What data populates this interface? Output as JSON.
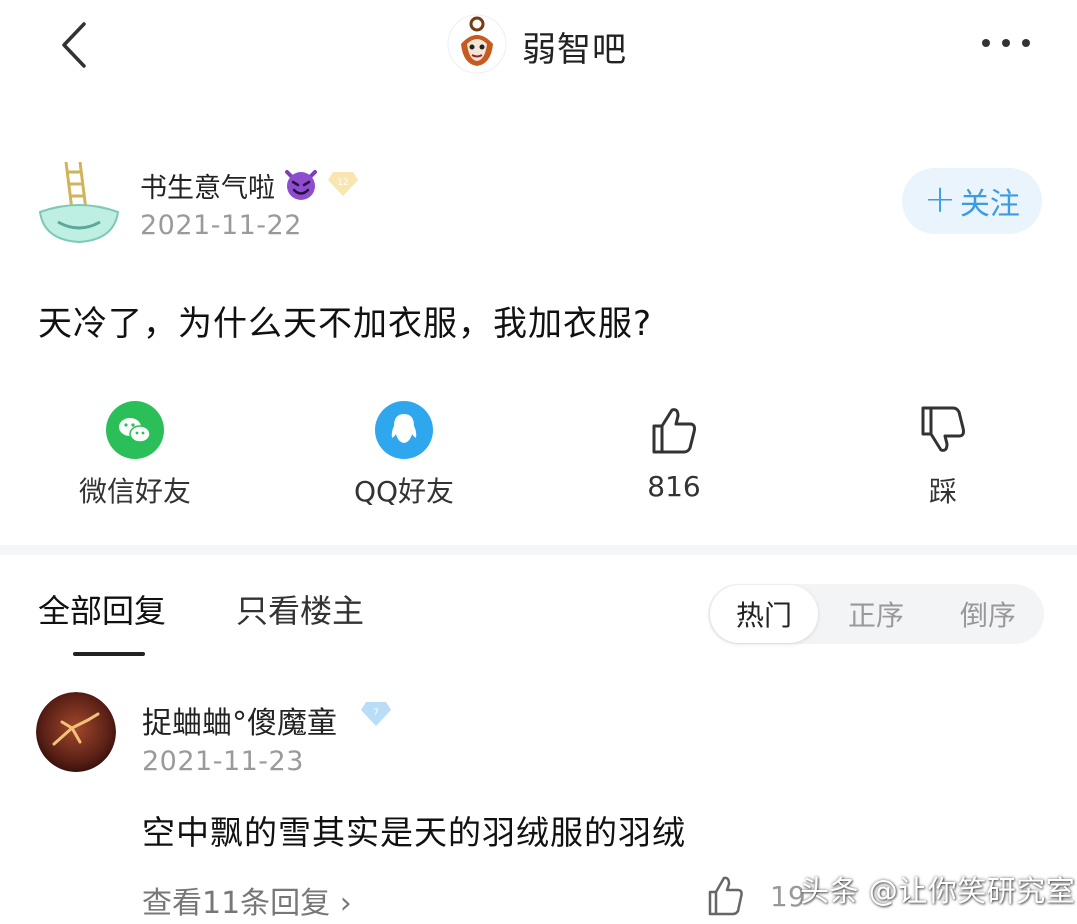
{
  "header": {
    "forum_name": "弱智吧",
    "back_icon": "chevron-left-icon",
    "more_icon": "more-horizontal-icon"
  },
  "post": {
    "author_name": "书生意气啦",
    "author_emoji": "smiling-devil-emoji",
    "author_badge": "12",
    "date": "2021-11-22",
    "follow_label": "关注",
    "follow_plus": "+",
    "text": "天冷了，为什么天不加衣服，我加衣服?",
    "accent_color": "#3b9be3"
  },
  "actions": [
    {
      "label": "微信好友",
      "icon": "wechat-icon",
      "color": "#2bbf5a"
    },
    {
      "label": "QQ好友",
      "icon": "qq-icon",
      "color": "#2fa7ee"
    },
    {
      "label": "816",
      "icon": "thumbs-up-icon"
    },
    {
      "label": "踩",
      "icon": "thumbs-down-icon"
    }
  ],
  "tabs": {
    "all": "全部回复",
    "owner_only": "只看楼主"
  },
  "sort": {
    "hot": "热门",
    "asc": "正序",
    "desc": "倒序"
  },
  "reply": {
    "author_name": "捉蛐蛐°傻魔童",
    "badge": "7",
    "date": "2021-11-23",
    "text": "空中飘的雪其实是天的羽绒服的羽绒",
    "view_replies": "查看11条回复 ›",
    "like_count": "19"
  },
  "watermark": "头条 @让你笑研究室"
}
